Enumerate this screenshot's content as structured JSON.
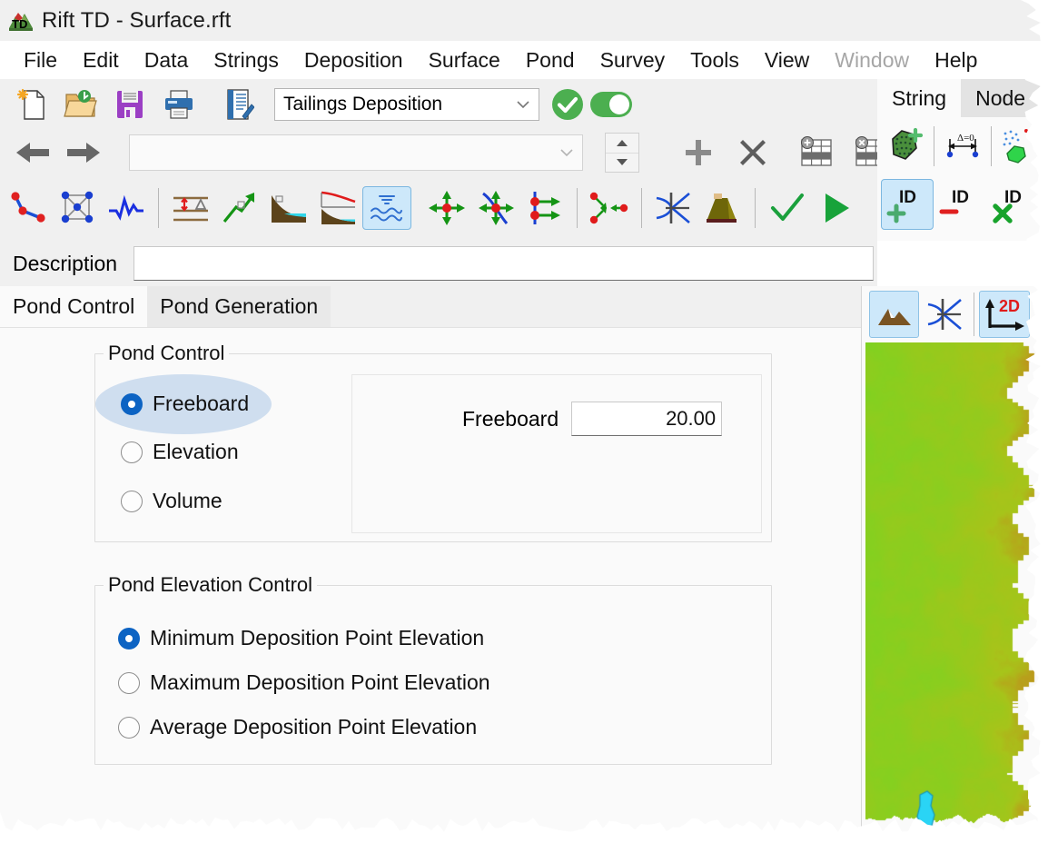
{
  "window": {
    "title": "Rift TD - Surface.rft",
    "app_icon": "terrain-td-logo-icon"
  },
  "menubar": {
    "items": [
      {
        "label": "File",
        "disabled": false
      },
      {
        "label": "Edit",
        "disabled": false
      },
      {
        "label": "Data",
        "disabled": false
      },
      {
        "label": "Strings",
        "disabled": false
      },
      {
        "label": "Deposition",
        "disabled": false
      },
      {
        "label": "Surface",
        "disabled": false
      },
      {
        "label": "Pond",
        "disabled": false
      },
      {
        "label": "Survey",
        "disabled": false
      },
      {
        "label": "Tools",
        "disabled": false
      },
      {
        "label": "View",
        "disabled": false
      },
      {
        "label": "Window",
        "disabled": true
      },
      {
        "label": "Help",
        "disabled": false
      }
    ]
  },
  "toolbar_row1": {
    "buttons": [
      {
        "icon": "new-document-icon",
        "name": "new-button"
      },
      {
        "icon": "open-folder-icon",
        "name": "open-button"
      },
      {
        "icon": "save-floppy-icon",
        "name": "save-button"
      },
      {
        "icon": "printer-icon",
        "name": "print-button"
      },
      {
        "icon": "edit-document-icon",
        "name": "edit-notes-button"
      }
    ],
    "combo": {
      "value": "Tailings Deposition",
      "chevron": "chevron-down-icon"
    },
    "apply": {
      "icon": "green-check-circle-icon",
      "name": "apply-button"
    },
    "toggle": {
      "icon": "toggle-switch-on-icon",
      "name": "enable-toggle",
      "state": "on"
    }
  },
  "toolbar_row2": {
    "back": {
      "icon": "arrow-left-icon"
    },
    "forward": {
      "icon": "arrow-right-icon"
    },
    "combo": {
      "value": "",
      "placeholder": "",
      "chevron": "chevron-down-icon"
    },
    "spinner": {
      "up": "spinner-up-icon",
      "down": "spinner-down-icon"
    },
    "buttons": [
      {
        "icon": "plus-icon",
        "name": "add-button"
      },
      {
        "icon": "cross-icon",
        "name": "delete-button"
      },
      {
        "icon": "table-add-row-icon",
        "name": "add-row-button"
      },
      {
        "icon": "table-remove-row-icon",
        "name": "remove-row-button"
      }
    ]
  },
  "toolbar_row3": {
    "buttons": [
      {
        "icon": "polyline-points-icon",
        "name": "tool-polyline",
        "selected": false
      },
      {
        "icon": "mesh-network-icon",
        "name": "tool-mesh",
        "selected": false
      },
      {
        "icon": "waveform-icon",
        "name": "tool-waveform",
        "selected": false
      },
      {
        "icon": "elevation-delta-icon",
        "name": "tool-elevation-delta",
        "selected": false
      },
      {
        "icon": "slope-arrow-icon",
        "name": "tool-slope-arrow",
        "selected": false
      },
      {
        "icon": "beach-profile-icon",
        "name": "tool-beach-profile",
        "selected": false
      },
      {
        "icon": "beach-curve-icon",
        "name": "tool-beach-curve",
        "selected": false
      },
      {
        "icon": "pond-water-icon",
        "name": "tool-pond-water",
        "selected": true
      },
      {
        "icon": "move-cross-icon",
        "name": "tool-move-point",
        "selected": false
      },
      {
        "icon": "move-on-curve-icon",
        "name": "tool-move-on-curve",
        "selected": false
      },
      {
        "icon": "offset-points-icon",
        "name": "tool-offset-points",
        "selected": false
      },
      {
        "icon": "connect-points-icon",
        "name": "tool-connect-points",
        "selected": false
      },
      {
        "icon": "intersect-lines-icon",
        "name": "tool-intersect",
        "selected": false
      },
      {
        "icon": "embankment-icon",
        "name": "tool-embankment",
        "selected": false
      },
      {
        "icon": "green-check-icon",
        "name": "tool-accept",
        "selected": false
      },
      {
        "icon": "green-play-icon",
        "name": "tool-run",
        "selected": false
      }
    ]
  },
  "right_panel": {
    "tabs": [
      {
        "label": "String",
        "active": true
      },
      {
        "label": "Node",
        "active": false
      }
    ],
    "row1": [
      {
        "icon": "polygon-add-icon",
        "name": "add-polygon-string-button"
      },
      {
        "icon": "delta-zero-measure-icon",
        "name": "measure-delta-button"
      },
      {
        "icon": "scatter-to-polygon-icon",
        "name": "points-to-polygon-button"
      }
    ],
    "row2": [
      {
        "icon": "id-plus-icon",
        "name": "add-id-button",
        "selected": true
      },
      {
        "icon": "id-minus-icon",
        "name": "remove-id-button",
        "selected": false
      },
      {
        "icon": "id-delete-icon",
        "name": "delete-id-button",
        "selected": false
      }
    ]
  },
  "description": {
    "label": "Description",
    "value": "",
    "placeholder": ""
  },
  "tabs": [
    {
      "label": "Pond Control",
      "active": true
    },
    {
      "label": "Pond Generation",
      "active": false
    }
  ],
  "pond_control": {
    "group_title": "Pond Control",
    "options": [
      {
        "label": "Freeboard",
        "checked": true,
        "hovered": true
      },
      {
        "label": "Elevation",
        "checked": false,
        "hovered": false
      },
      {
        "label": "Volume",
        "checked": false,
        "hovered": false
      }
    ],
    "field": {
      "label": "Freeboard",
      "value": "20.00"
    }
  },
  "pond_elevation_control": {
    "group_title": "Pond Elevation Control",
    "options": [
      {
        "label": "Minimum Deposition Point Elevation",
        "checked": true
      },
      {
        "label": "Maximum Deposition Point Elevation",
        "checked": false
      },
      {
        "label": "Average Deposition Point Elevation",
        "checked": false
      }
    ]
  },
  "view_panel": {
    "buttons": [
      {
        "icon": "terrain-mountains-icon",
        "name": "view-terrain-button",
        "selected": true
      },
      {
        "icon": "intersect-lines-icon",
        "name": "view-strings-button",
        "selected": false
      },
      {
        "icon": "axis-2d-icon",
        "name": "view-2d-button",
        "selected": true
      }
    ],
    "map": {
      "description": "terrain-elevation-heatmap",
      "low_color": "#7ed321",
      "mid_color": "#a8c41a",
      "high_color": "#d2691e",
      "pond_color": "#2ad4f5"
    }
  },
  "colors": {
    "accent": "#0c63c3",
    "window_bg": "#f0f0f0",
    "panel_bg": "#fafafa",
    "selection": "#cde8fa",
    "green": "#4caf50"
  }
}
